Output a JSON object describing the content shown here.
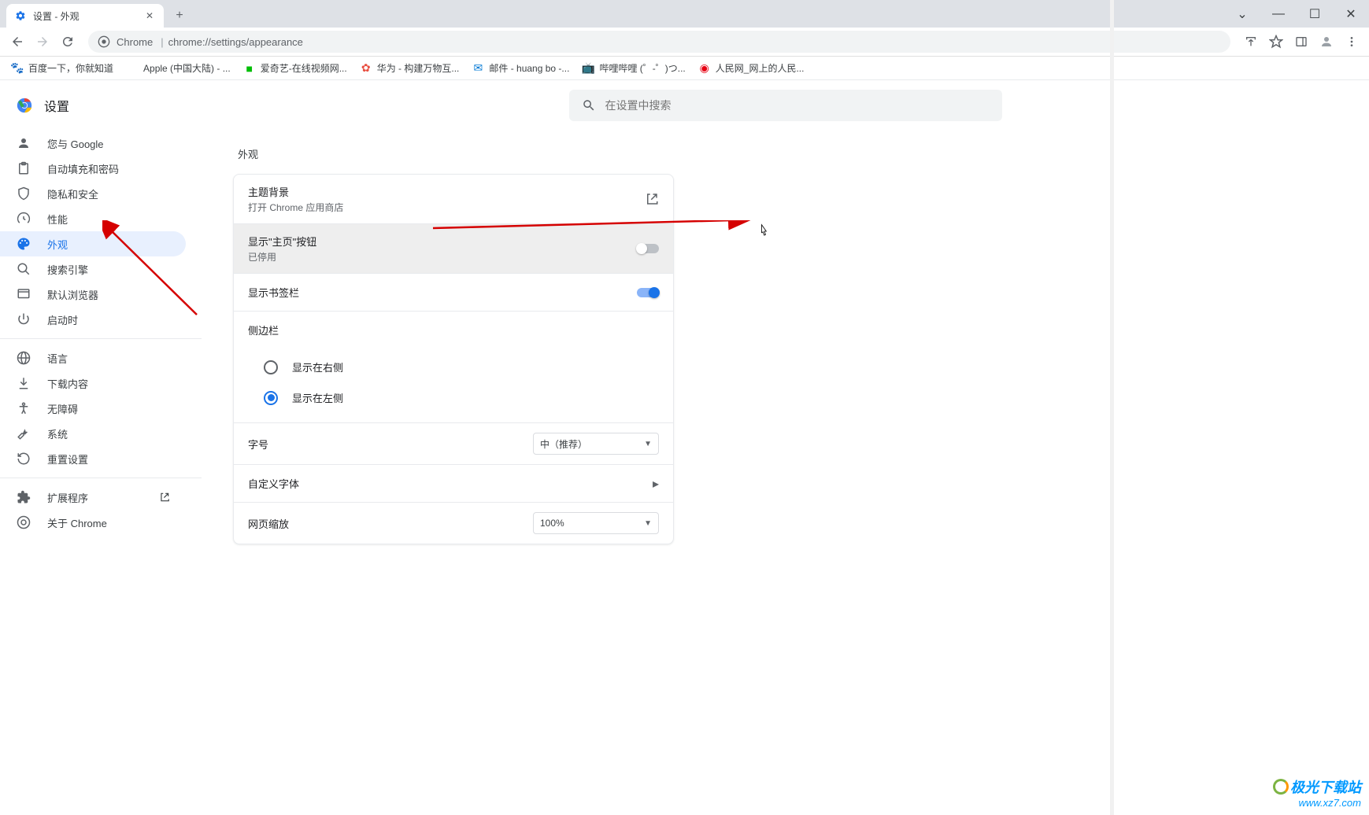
{
  "window": {
    "tab_title": "设置 - 外观",
    "new_tab": "+",
    "controls": {
      "chevron": "⌄",
      "min": "—",
      "max": "☐",
      "close": "✕"
    }
  },
  "toolbar": {
    "chrome_prefix": "Chrome",
    "url": "chrome://settings/appearance"
  },
  "bookmarks": [
    {
      "icon": "🐾",
      "label": "百度一下，你就知道",
      "color": "#2932e1"
    },
    {
      "icon": "",
      "label": "Apple (中国大陆) - ...",
      "color": "#000"
    },
    {
      "icon": "■",
      "label": "爱奇艺-在线视频网...",
      "color": "#00be06"
    },
    {
      "icon": "✿",
      "label": "华为 - 构建万物互...",
      "color": "#e84e40"
    },
    {
      "icon": "✉",
      "label": "邮件 - huang bo -...",
      "color": "#0078d4"
    },
    {
      "icon": "📺",
      "label": "哔哩哔哩 (゜-゜)つ...",
      "color": "#00a1d6"
    },
    {
      "icon": "◉",
      "label": "人民网_网上的人民...",
      "color": "#e60012"
    }
  ],
  "app": {
    "title": "设置"
  },
  "sidebar": {
    "items": [
      {
        "label": "您与 Google"
      },
      {
        "label": "自动填充和密码"
      },
      {
        "label": "隐私和安全"
      },
      {
        "label": "性能"
      },
      {
        "label": "外观"
      },
      {
        "label": "搜索引擎"
      },
      {
        "label": "默认浏览器"
      },
      {
        "label": "启动时"
      },
      {
        "label": "语言"
      },
      {
        "label": "下载内容"
      },
      {
        "label": "无障碍"
      },
      {
        "label": "系统"
      },
      {
        "label": "重置设置"
      },
      {
        "label": "扩展程序"
      },
      {
        "label": "关于 Chrome"
      }
    ]
  },
  "search": {
    "placeholder": "在设置中搜索"
  },
  "section": {
    "title": "外观",
    "theme": {
      "title": "主题背景",
      "sub": "打开 Chrome 应用商店"
    },
    "home_button": {
      "title": "显示\"主页\"按钮",
      "sub": "已停用",
      "on": false
    },
    "bookmarks_bar": {
      "title": "显示书签栏",
      "on": true
    },
    "sidebar_section": {
      "title": "侧边栏",
      "options": [
        {
          "label": "显示在右侧",
          "selected": false
        },
        {
          "label": "显示在左侧",
          "selected": true
        }
      ]
    },
    "font_size": {
      "title": "字号",
      "value": "中（推荐）"
    },
    "custom_fonts": {
      "title": "自定义字体"
    },
    "page_zoom": {
      "title": "网页缩放",
      "value": "100%"
    }
  },
  "watermark": {
    "brand": "极光下载站",
    "url": "www.xz7.com"
  }
}
